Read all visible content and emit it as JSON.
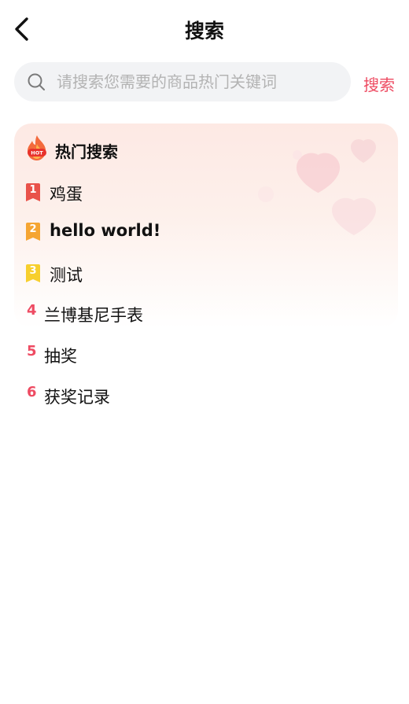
{
  "header": {
    "title": "搜索"
  },
  "search": {
    "placeholder": "请搜索您需要的商品热门关键词",
    "value": "",
    "button_label": "搜索"
  },
  "hot": {
    "title": "热门搜索",
    "icon_text": "HOT",
    "items": [
      {
        "rank": "1",
        "label": "鸡蛋",
        "badge_color": "#e9524a"
      },
      {
        "rank": "2",
        "label": "hello world!",
        "badge_color": "#f5a532"
      },
      {
        "rank": "3",
        "label": "测试",
        "badge_color": "#f7cf2d"
      },
      {
        "rank": "4",
        "label": "兰博基尼手表"
      },
      {
        "rank": "5",
        "label": "抽奖"
      },
      {
        "rank": "6",
        "label": "获奖记录"
      }
    ]
  },
  "colors": {
    "accent": "#ee4b62",
    "search_bg": "#f2f3f5",
    "placeholder": "#b3b3b3"
  },
  "icons": {
    "back": "chevron-left-icon",
    "search": "search-icon",
    "hot": "flame-icon"
  }
}
